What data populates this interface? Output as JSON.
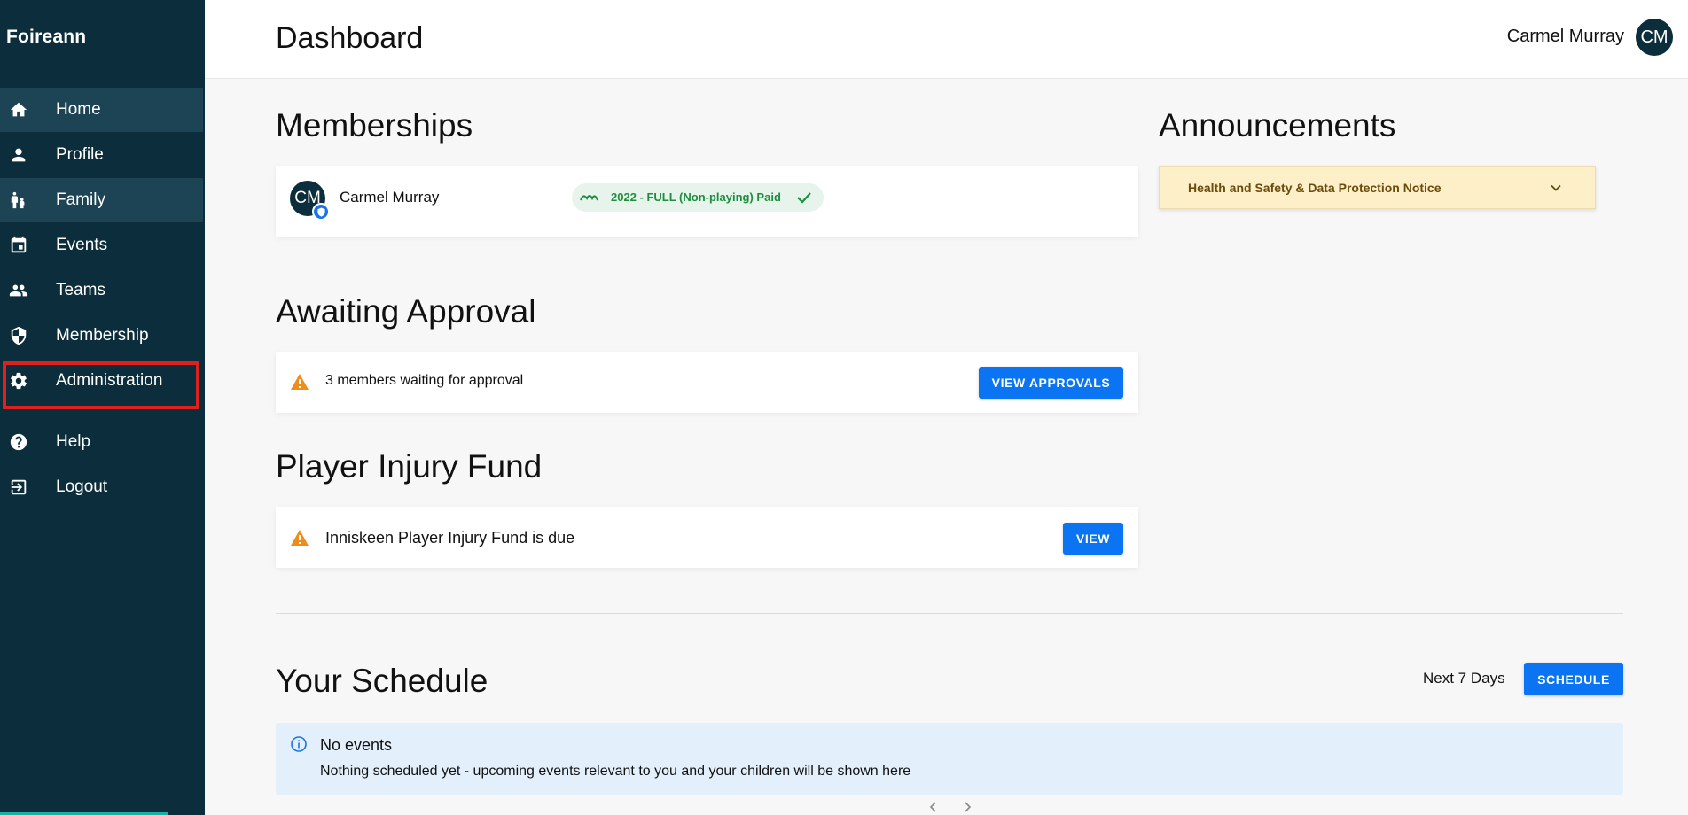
{
  "app": {
    "brand": "Foireann"
  },
  "sidebar": {
    "items": [
      {
        "label": "Home",
        "icon": "home-icon"
      },
      {
        "label": "Profile",
        "icon": "person-icon"
      },
      {
        "label": "Family",
        "icon": "family-icon"
      },
      {
        "label": "Events",
        "icon": "calendar-icon"
      },
      {
        "label": "Teams",
        "icon": "group-icon"
      },
      {
        "label": "Membership",
        "icon": "shield-icon"
      },
      {
        "label": "Administration",
        "icon": "gear-icon"
      },
      {
        "label": "Help",
        "icon": "help-icon"
      },
      {
        "label": "Logout",
        "icon": "logout-icon"
      }
    ],
    "active_items": [
      "Home",
      "Family"
    ],
    "highlighted_item": "Administration"
  },
  "header": {
    "title": "Dashboard",
    "user_name": "Carmel Murray",
    "user_initials": "CM"
  },
  "memberships": {
    "title": "Memberships",
    "member_name": "Carmel Murray",
    "member_initials": "CM",
    "status_chip": "2022 - FULL (Non-playing) Paid"
  },
  "announcements": {
    "title": "Announcements",
    "items": [
      {
        "title": "Health and Safety & Data Protection Notice"
      }
    ]
  },
  "approval": {
    "title": "Awaiting Approval",
    "message": "3 members waiting for approval",
    "button": "VIEW APPROVALS"
  },
  "injury_fund": {
    "title": "Player Injury Fund",
    "message": "Inniskeen Player Injury Fund is due",
    "button": "VIEW"
  },
  "schedule": {
    "title": "Your Schedule",
    "range": "Next 7 Days",
    "button": "SCHEDULE",
    "empty_title": "No events",
    "empty_text": "Nothing scheduled yet - upcoming events relevant to you and your children will be shown here"
  },
  "colors": {
    "sidebar_bg": "#0c2d3b",
    "accent": "#0a74f2",
    "success": "#1e8e3e",
    "warning": "#f08c1a",
    "highlight": "#e0201f"
  }
}
